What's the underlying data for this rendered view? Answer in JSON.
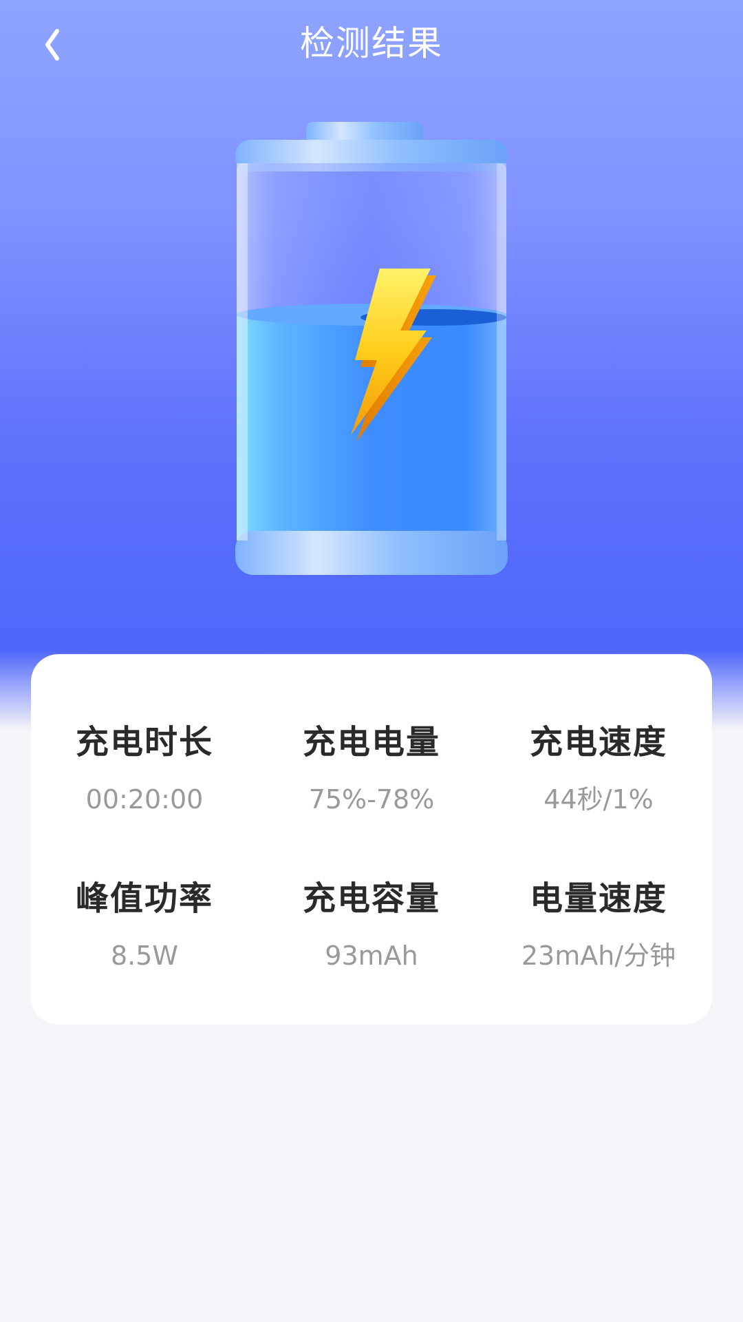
{
  "nav": {
    "title": "检测结果",
    "back_icon": "chevron-left-icon"
  },
  "battery_illustration": {
    "icon": "battery-charging-icon",
    "fill_level": 0.63
  },
  "stats": [
    {
      "label": "充电时长",
      "value": "00:20:00"
    },
    {
      "label": "充电电量",
      "value": "75%-78%"
    },
    {
      "label": "充电速度",
      "value": "44秒/1%"
    },
    {
      "label": "峰值功率",
      "value": "8.5W"
    },
    {
      "label": "充电容量",
      "value": "93mAh"
    },
    {
      "label": "电量速度",
      "value": "23mAh/分钟"
    }
  ],
  "colors": {
    "header_top": "#8fa4ff",
    "header_bottom": "#4e66fb",
    "page_bg": "#f5f4f8",
    "card_bg": "#ffffff",
    "label": "#2a2a2a",
    "value": "#999999"
  }
}
